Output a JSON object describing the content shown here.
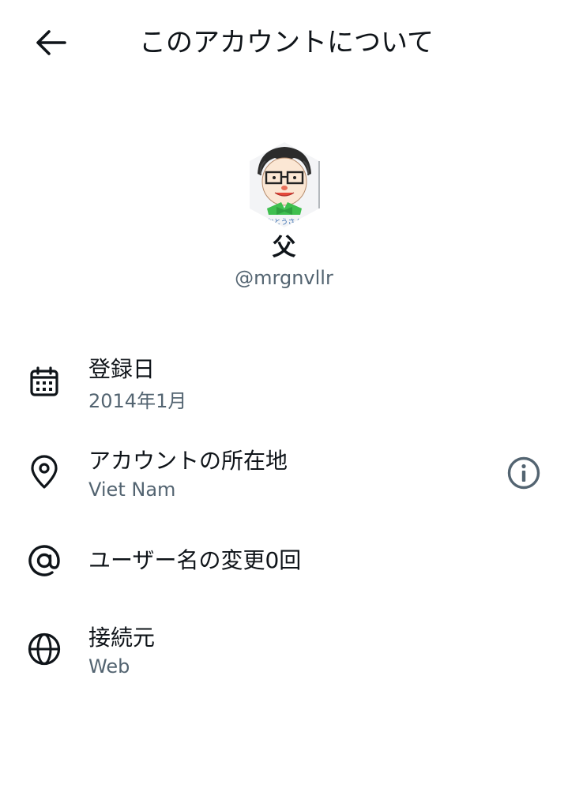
{
  "header": {
    "title": "このアカウントについて",
    "back_icon": "arrow-left-icon"
  },
  "profile": {
    "display_name": "父",
    "handle": "@mrgnvllr",
    "avatar_caption": "おとうさん"
  },
  "details": {
    "joined": {
      "icon": "calendar-icon",
      "label": "登録日",
      "value": "2014年1月"
    },
    "location": {
      "icon": "location-pin-icon",
      "label": "アカウントの所在地",
      "value": "Viet Nam",
      "action_icon": "info-icon"
    },
    "username_changes": {
      "icon": "at-sign-icon",
      "label": "ユーザー名の変更0回"
    },
    "connected_via": {
      "icon": "globe-icon",
      "label": "接続元",
      "value": "Web"
    }
  },
  "colors": {
    "text_primary": "#0f1419",
    "text_secondary": "#536471",
    "icon": "#0f1419",
    "info_icon": "#536471",
    "background": "#ffffff"
  }
}
